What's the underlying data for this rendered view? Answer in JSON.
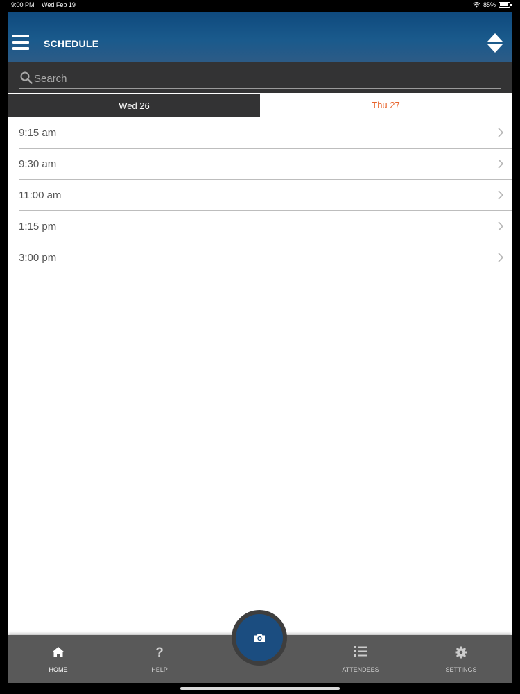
{
  "status": {
    "time": "9:00 PM",
    "date": "Wed Feb 19",
    "battery": "85%"
  },
  "header": {
    "title": "SCHEDULE"
  },
  "search": {
    "placeholder": "Search"
  },
  "tabs": [
    {
      "label": "Wed 26",
      "active": true
    },
    {
      "label": "Thu 27",
      "active": false
    }
  ],
  "schedule": [
    {
      "time": "9:15 am"
    },
    {
      "time": "9:30 am"
    },
    {
      "time": "11:00 am"
    },
    {
      "time": "1:15 pm"
    },
    {
      "time": "3:00 pm"
    }
  ],
  "tabbar": {
    "home": "HOME",
    "help": "HELP",
    "attendees": "ATTENDEES",
    "settings": "SETTINGS"
  },
  "colors": {
    "header": "#1a5a8c",
    "dark": "#333334",
    "accent": "#e8642c",
    "fab": "#1b4d80"
  },
  "icons": [
    "menu-icon",
    "sort-icon",
    "search-icon",
    "chevron-right-icon",
    "home-icon",
    "help-icon",
    "camera-icon",
    "list-icon",
    "gear-icon"
  ]
}
